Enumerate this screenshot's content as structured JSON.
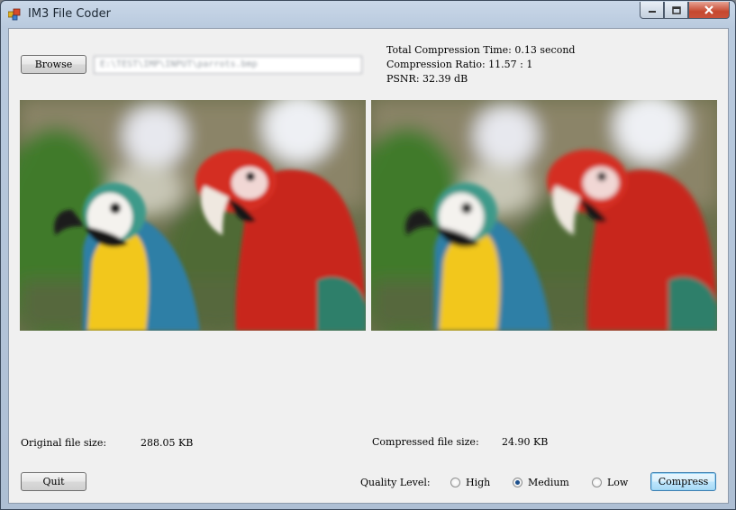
{
  "window": {
    "title": "IM3 File Coder"
  },
  "browse": {
    "label": "Browse",
    "path": "E:\\TEST\\IMP\\INPUT\\parrots.bmp"
  },
  "stats": {
    "time": "Total Compression Time: 0.13 second",
    "ratio": "Compression Ratio: 11.57 : 1",
    "psnr": "PSNR: 32.39 dB"
  },
  "sizes": {
    "original_label": "Original file size:",
    "original_value": "288.05 KB",
    "compressed_label": "Compressed file size:",
    "compressed_value": "24.90 KB"
  },
  "quality": {
    "label": "Quality Level:",
    "options": [
      {
        "label": "High",
        "selected": false
      },
      {
        "label": "Medium",
        "selected": true
      },
      {
        "label": "Low",
        "selected": false
      }
    ]
  },
  "buttons": {
    "quit": "Quit",
    "compress": "Compress"
  },
  "images": {
    "original": "parrots-original-image",
    "compressed": "parrots-compressed-image"
  }
}
